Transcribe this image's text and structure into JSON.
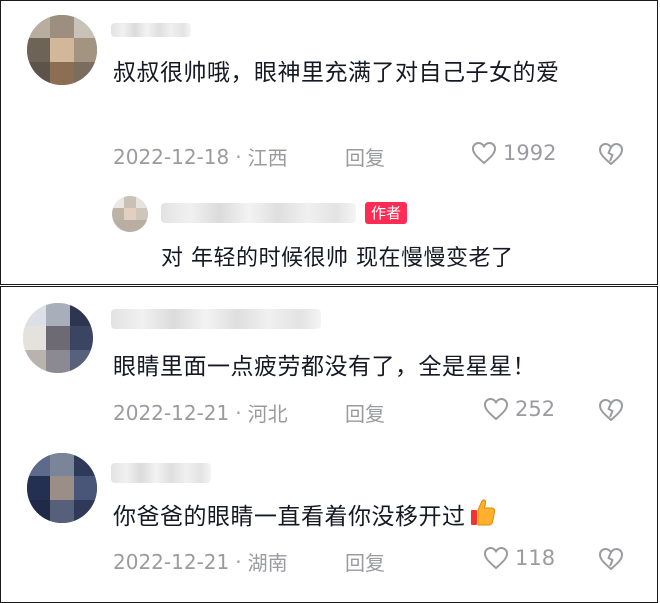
{
  "comments": [
    {
      "content": "叔叔很帅哦，眼神里充满了对自己子女的爱",
      "date": "2022-12-18",
      "sep": "·",
      "location": "江西",
      "reply_label": "回复",
      "likes": "1992",
      "replies": [
        {
          "author_tag": "作者",
          "content": "对 年轻的时候很帅 现在慢慢变老了"
        }
      ]
    },
    {
      "content": "眼睛里面一点疲劳都没有了，全是星星！",
      "date": "2022-12-21",
      "sep": "·",
      "location": "河北",
      "reply_label": "回复",
      "likes": "252"
    },
    {
      "content": "你爸爸的眼睛一直看着你没移开过",
      "date": "2022-12-21",
      "sep": "·",
      "location": "湖南",
      "reply_label": "回复",
      "likes": "118",
      "emoji": "thumbs-up"
    }
  ],
  "colors": {
    "text": "#161823",
    "meta": "#9a9b9f",
    "author_tag": "#fe2c55"
  }
}
